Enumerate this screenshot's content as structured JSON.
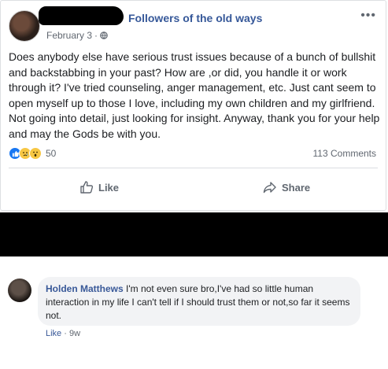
{
  "post": {
    "group_name": "Followers of the old ways",
    "date": "February 3",
    "separator": "·",
    "more_label": "•••",
    "text": "Does anybody else have serious trust issues because of a bunch of bullshit and backstabbing in your past? How are ,or did, you handle it or work through it? I've tried counseling, anger management, etc. Just cant seem to open myself up to those I love, including my own children and my girlfriend. Not going into detail, just looking for insight. Anyway, thank you for your help and may the Gods be with you.",
    "reaction_count": "50",
    "comments_count": "113 Comments",
    "actions": {
      "like": "Like",
      "share": "Share"
    }
  },
  "comment": {
    "author": "Holden Matthews",
    "text": "I'm not even sure bro,I've had so little human interaction in my life I can't tell if I should trust them or not,so far it seems not.",
    "like_label": "Like",
    "separator": "·",
    "age": "9w"
  },
  "colors": {
    "link": "#365899",
    "like_blue": "#1877f2",
    "muted": "#606770"
  }
}
